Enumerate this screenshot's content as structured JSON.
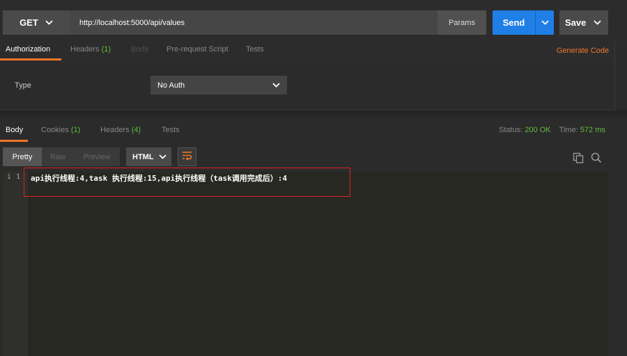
{
  "request": {
    "method": "GET",
    "url": "http://localhost:5000/api/values",
    "params_label": "Params",
    "send_label": "Send",
    "save_label": "Save"
  },
  "request_tabs": {
    "authorization": "Authorization",
    "headers": "Headers",
    "headers_count": "(1)",
    "body": "Body",
    "prerequest": "Pre-request Script",
    "tests": "Tests",
    "generate_code": "Generate Code"
  },
  "auth": {
    "type_label": "Type",
    "selected": "No Auth"
  },
  "response_tabs": {
    "body": "Body",
    "cookies": "Cookies",
    "cookies_count": "(1)",
    "headers": "Headers",
    "headers_count": "(4)",
    "tests": "Tests"
  },
  "status": {
    "status_label": "Status:",
    "status_value": "200 OK",
    "time_label": "Time:",
    "time_value": "572 ms"
  },
  "view": {
    "pretty": "Pretty",
    "raw": "Raw",
    "preview": "Preview",
    "format": "HTML"
  },
  "editor": {
    "info_marker": "i",
    "line_number": "1",
    "line_text": "api执行线程:4,task 执行线程:15,api执行线程（task调用完成后）:4"
  },
  "colors": {
    "accent": "#f0772a",
    "send": "#1f7fe6",
    "success": "#5fbf3a",
    "highlight_border": "#e02020"
  },
  "icons": [
    "chevron-down-icon",
    "wrap-lines-icon",
    "copy-icon",
    "search-icon"
  ]
}
